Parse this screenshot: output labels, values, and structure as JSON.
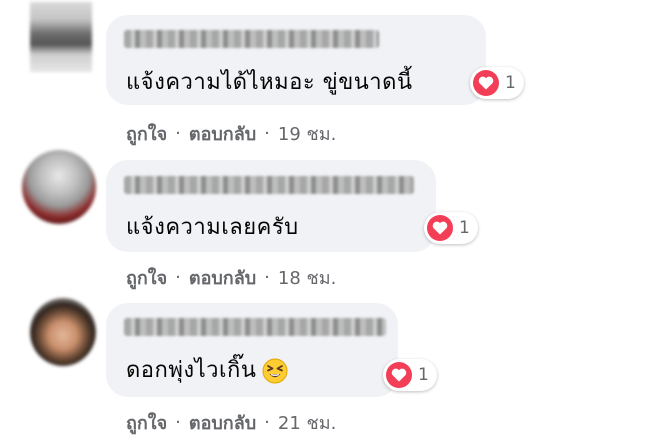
{
  "comments": [
    {
      "text": "แจ้งความได้ไหมอะ ขู่ขนาดนี้",
      "reaction_count": "1",
      "like_label": "ถูกใจ",
      "reply_label": "ตอบกลับ",
      "time": "19 ชม."
    },
    {
      "text": "แจ้งความเลยครับ",
      "reaction_count": "1",
      "like_label": "ถูกใจ",
      "reply_label": "ตอบกลับ",
      "time": "18 ชม."
    },
    {
      "text": "ดอกพุ่งไวเกิ๊น",
      "reaction_count": "1",
      "like_label": "ถูกใจ",
      "reply_label": "ตอบกลับ",
      "time": "21 ชม."
    }
  ],
  "separator": "·",
  "icons": {
    "reaction": "heart-icon",
    "emoji": "tired-face-emoji-icon"
  },
  "colors": {
    "bubble": "#f0f2f5",
    "heart": "#f33e58",
    "meta_text": "#65676b"
  }
}
